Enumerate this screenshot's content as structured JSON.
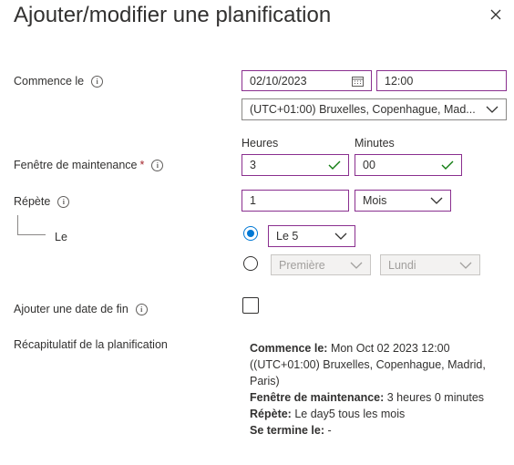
{
  "dialog": {
    "title": "Ajouter/modifier une planification"
  },
  "start": {
    "label": "Commence le",
    "date_value": "02/10/2023",
    "time_value": "12:00",
    "timezone_value": "(UTC+01:00) Bruxelles, Copenhague, Mad..."
  },
  "maintenance": {
    "label": "Fenêtre de maintenance",
    "required_mark": "*",
    "hours_label": "Heures",
    "minutes_label": "Minutes",
    "hours_value": "3",
    "minutes_value": "00"
  },
  "repeat": {
    "label": "Répète",
    "interval_value": "1",
    "unit_value": "Mois",
    "on_label": "Le",
    "option1_value": "Le 5",
    "option1_selected": true,
    "option2_week_value": "Première",
    "option2_day_value": "Lundi"
  },
  "end_date": {
    "label": "Ajouter une date de fin",
    "checked": false
  },
  "summary": {
    "label": "Récapitulatif de la planification",
    "start_key": "Commence le:",
    "start_value": "Mon Oct 02 2023 12:00",
    "timezone_text": "((UTC+01:00) Bruxelles, Copenhague, Madrid, Paris)",
    "window_key": "Fenêtre de maintenance:",
    "window_value": "3 heures 0 minutes",
    "repeat_key": "Répète:",
    "repeat_value": "Le day5 tous les mois",
    "end_key": "Se termine le:",
    "end_value": "-"
  },
  "colors": {
    "accent_border": "#8a2f8f",
    "radio_blue": "#0078d4",
    "valid_check": "#107c10"
  }
}
